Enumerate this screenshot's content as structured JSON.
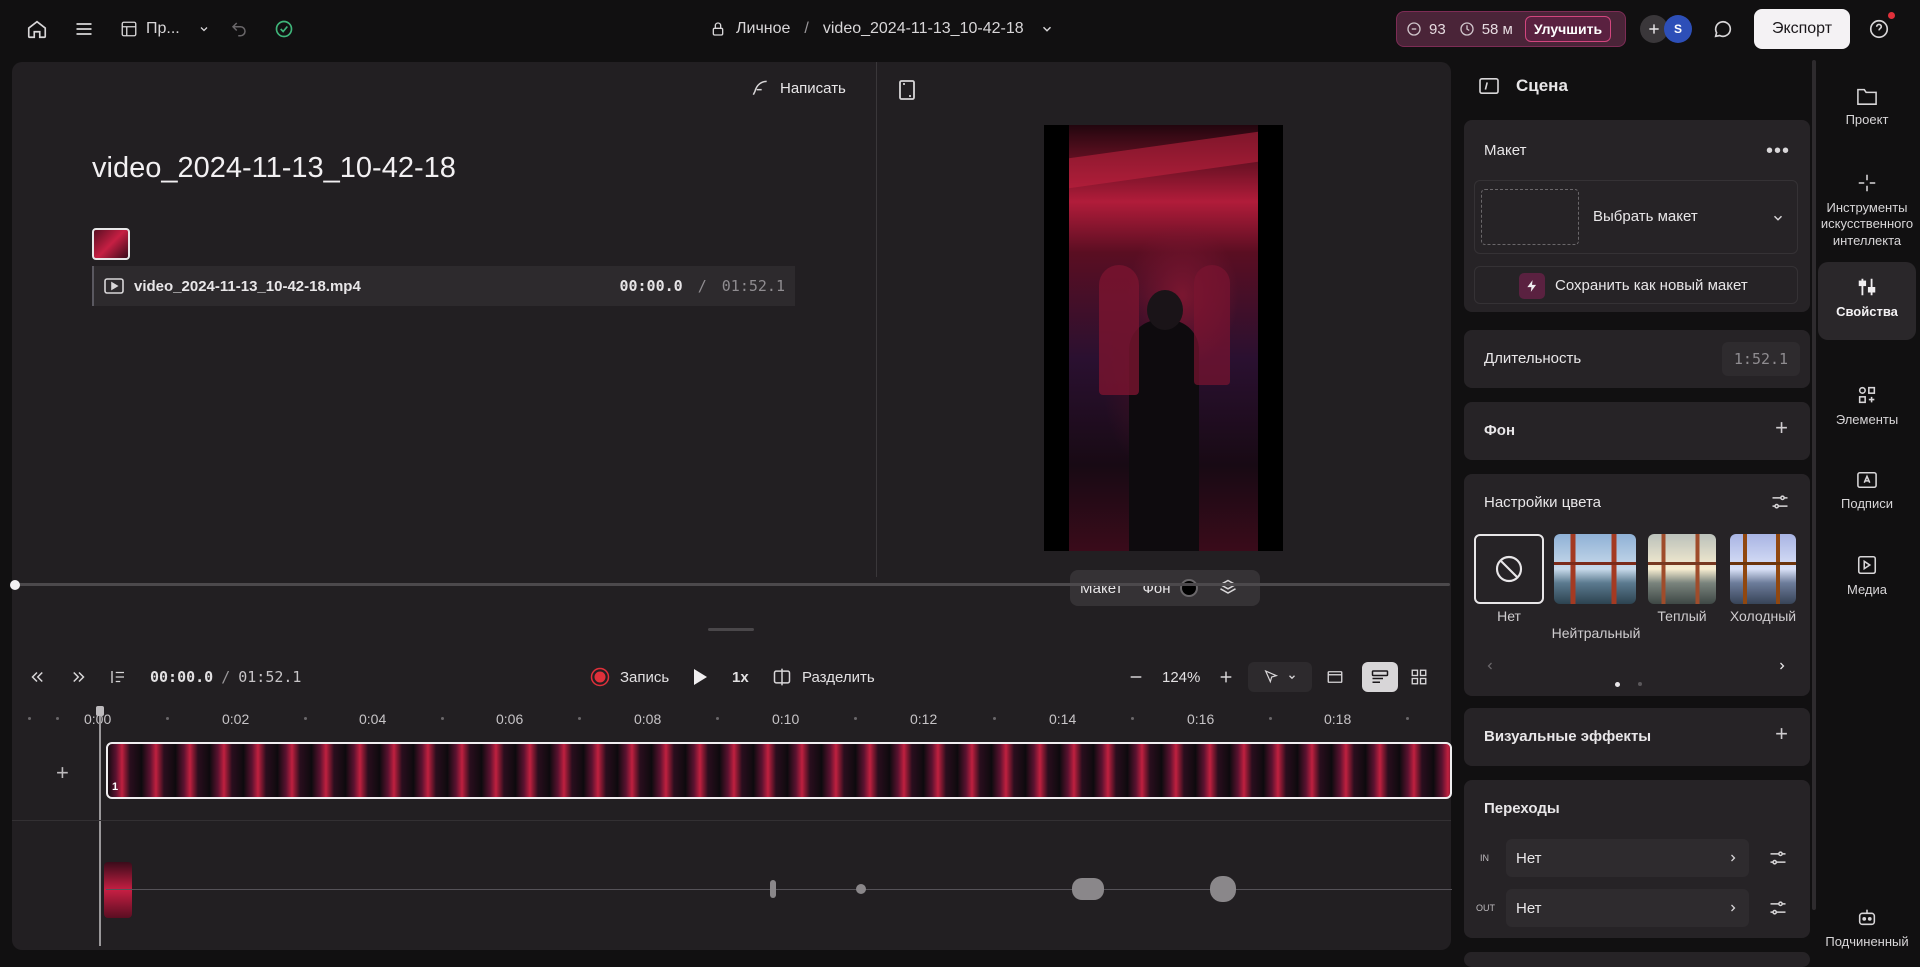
{
  "topbar": {
    "project_short": "Пр...",
    "breadcrumb_space": "Личное",
    "breadcrumb_sep": "/",
    "breadcrumb_file": "video_2024-11-13_10-42-18",
    "credits_count": "93",
    "time_left": "58 м",
    "upgrade_label": "Улучшить",
    "avatar_letter": "S",
    "export_label": "Экспорт"
  },
  "script": {
    "write_label": "Написать",
    "title": "video_2024-11-13_10-42-18",
    "clip_name": "video_2024-11-13_10-42-18.mp4",
    "clip_current": "00:00.0",
    "clip_sep": "/",
    "clip_total": "01:52.1"
  },
  "preview_toolbar": {
    "layout": "Макет",
    "background": "Фон"
  },
  "timeline": {
    "current": "00:00.0",
    "sep": "/",
    "total": "01:52.1",
    "record_label": "Запись",
    "speed": "1x",
    "split_label": "Разделить",
    "zoom": "124%",
    "ruler": [
      "0:00",
      "0:02",
      "0:04",
      "0:06",
      "0:08",
      "0:10",
      "0:12",
      "0:14",
      "0:16",
      "0:18"
    ],
    "clip_index": "1"
  },
  "props": {
    "panel_title": "Сцена",
    "layout_section": "Макет",
    "choose_layout": "Выбрать макет",
    "save_layout": "Сохранить как новый макет",
    "duration_label": "Длительность",
    "duration_value": "1:52.1",
    "background_label": "Фон",
    "color_label": "Настройки цвета",
    "swatches": [
      "Нет",
      "Нейтральный",
      "Теплый",
      "Холодный"
    ],
    "effects_label": "Визуальные эффекты",
    "transitions_label": "Переходы",
    "in_label": "IN",
    "out_label": "OUT",
    "in_value": "Нет",
    "out_value": "Нет"
  },
  "nav": {
    "project": "Проект",
    "ai_tools": "Инструменты искусственного интеллекта",
    "properties": "Свойства",
    "elements": "Элементы",
    "captions": "Подписи",
    "media": "Медиа",
    "subordinate": "Подчиненный"
  },
  "colors": {
    "accent": "#d2467e",
    "record": "#e0303a",
    "panel": "#262326",
    "background": "#111011"
  }
}
